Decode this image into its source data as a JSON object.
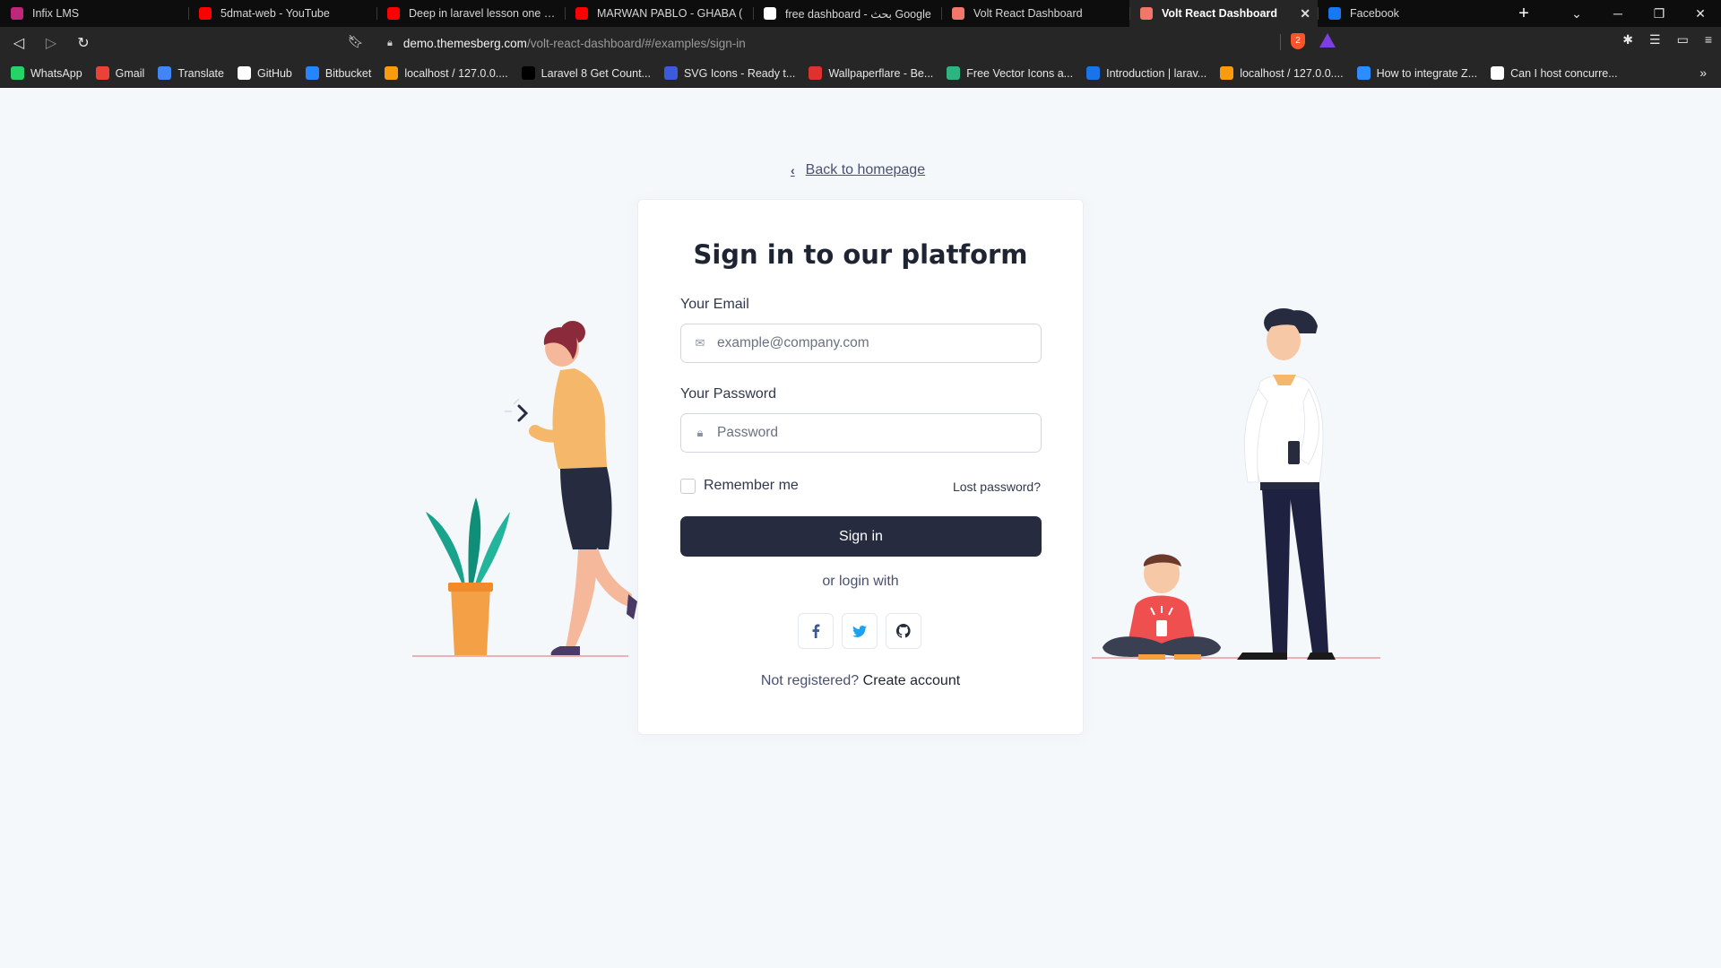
{
  "browser": {
    "tabs": [
      {
        "title": "Infix LMS",
        "favicon": "infix-icon",
        "color": "#c0267a"
      },
      {
        "title": "5dmat-web - YouTube",
        "favicon": "youtube-icon",
        "color": "#ff0000"
      },
      {
        "title": "Deep in laravel lesson one what",
        "favicon": "youtube-icon",
        "color": "#ff0000"
      },
      {
        "title": "MARWAN PABLO - GHABA (",
        "favicon": "youtube-icon",
        "color": "#ff0000"
      },
      {
        "title": "free dashboard - بحث Google",
        "favicon": "google-icon",
        "color": "#ffffff"
      },
      {
        "title": "Volt React Dashboard",
        "favicon": "volt-icon",
        "color": "#f0776a"
      },
      {
        "title": "Volt React Dashboard",
        "favicon": "volt-icon",
        "color": "#f0776a",
        "active": true
      },
      {
        "title": "Facebook",
        "favicon": "facebook-icon",
        "color": "#1877f2"
      }
    ],
    "url_host": "demo.themesberg.com",
    "url_path": "/volt-react-dashboard/#/examples/sign-in",
    "brave_badge": "2",
    "bookmarks": [
      {
        "label": "WhatsApp",
        "icon": "whatsapp-icon",
        "color": "#25d366"
      },
      {
        "label": "Gmail",
        "icon": "gmail-icon",
        "color": "#ea4335"
      },
      {
        "label": "Translate",
        "icon": "translate-icon",
        "color": "#4285f4"
      },
      {
        "label": "GitHub",
        "icon": "github-icon",
        "color": "#ffffff"
      },
      {
        "label": "Bitbucket",
        "icon": "bitbucket-icon",
        "color": "#2684ff"
      },
      {
        "label": "localhost / 127.0.0....",
        "icon": "phpmyadmin-icon",
        "color": "#f89c0e"
      },
      {
        "label": "Laravel 8 Get Count...",
        "icon": "dev-icon",
        "color": "#000000"
      },
      {
        "label": "SVG Icons - Ready t...",
        "icon": "svg-icon",
        "color": "#3b5bdb"
      },
      {
        "label": "Wallpaperflare - Be...",
        "icon": "flame-icon",
        "color": "#e03131"
      },
      {
        "label": "Free Vector Icons a...",
        "icon": "vector-icon",
        "color": "#2fb380"
      },
      {
        "label": "Introduction | larav...",
        "icon": "s-icon",
        "color": "#1a73e8"
      },
      {
        "label": "localhost / 127.0.0....",
        "icon": "phpmyadmin-icon",
        "color": "#f89c0e"
      },
      {
        "label": "How to integrate Z...",
        "icon": "z-icon",
        "color": "#2d8cff"
      },
      {
        "label": "Can I host concurre...",
        "icon": "ring-icon",
        "color": "#ffffff"
      }
    ]
  },
  "page": {
    "back_link": "Back to homepage",
    "title": "Sign in to our platform",
    "email_label": "Your Email",
    "email_placeholder": "example@company.com",
    "password_label": "Your Password",
    "password_placeholder": "Password",
    "remember_label": "Remember me",
    "lost_password": "Lost password?",
    "signin_label": "Sign in",
    "or_login_with": "or login with",
    "not_registered": "Not registered?",
    "create_account": "Create account",
    "colors": {
      "primary": "#262b40",
      "background": "#f5f8fb",
      "facebook": "#3b5998",
      "twitter": "#1da1f2",
      "github": "#262b40"
    }
  }
}
